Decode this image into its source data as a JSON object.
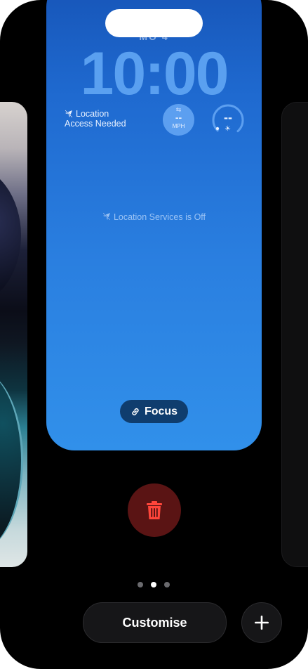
{
  "lockscreen": {
    "date_peek": "MO 4",
    "time": "10:00",
    "location_widget": {
      "icon": "location-off-icon",
      "line1": "Location",
      "line2": "Access Needed"
    },
    "speed_widget": {
      "icon": "wind-arrow-icon",
      "value": "--",
      "unit": "MPH"
    },
    "gauge_widget": {
      "value": "--",
      "icon": "sun-icon"
    },
    "location_services_text": "Location Services is Off",
    "focus_label": "Focus",
    "focus_icon": "link-icon"
  },
  "controls": {
    "delete_icon": "trash-icon",
    "page_count": 3,
    "active_page": 2,
    "customise_label": "Customise",
    "add_icon": "plus-icon"
  },
  "colors": {
    "wallpaper_top": "#1654b7",
    "wallpaper_bottom": "#3190ea",
    "delete_bg": "#5a1414",
    "delete_icon": "#ff453a"
  }
}
